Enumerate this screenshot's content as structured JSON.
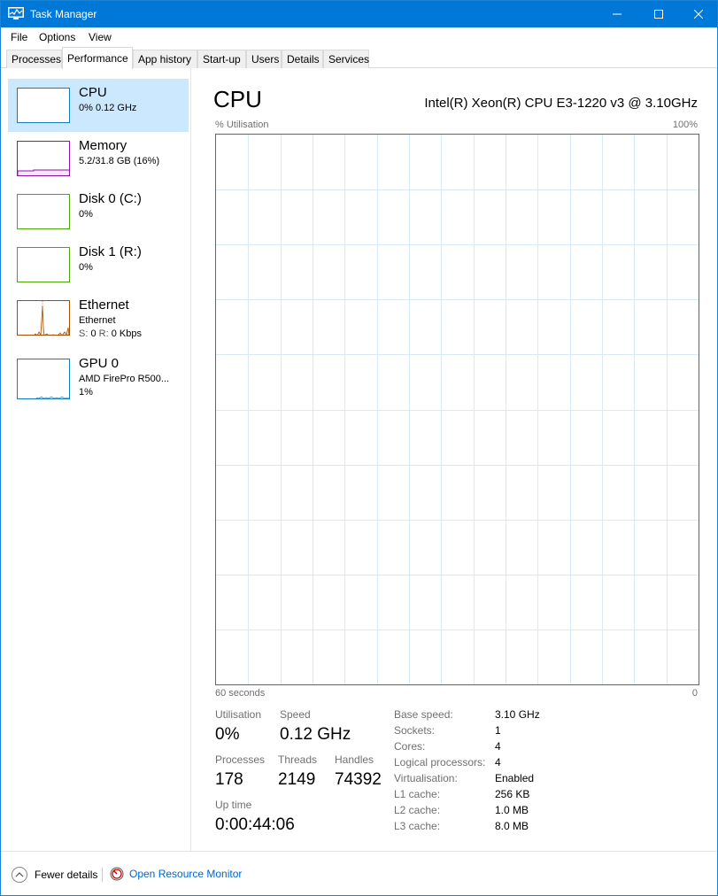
{
  "window": {
    "title": "Task Manager"
  },
  "menu": {
    "file": "File",
    "options": "Options",
    "view": "View"
  },
  "tabs": [
    {
      "label": "Processes"
    },
    {
      "label": "Performance"
    },
    {
      "label": "App history"
    },
    {
      "label": "Start-up"
    },
    {
      "label": "Users"
    },
    {
      "label": "Details"
    },
    {
      "label": "Services"
    }
  ],
  "sidebar": {
    "items": [
      {
        "name": "CPU",
        "sub": "0% 0.12 GHz",
        "color": "#117dbb"
      },
      {
        "name": "Memory",
        "sub": "5.2/31.8 GB (16%)",
        "color": "#8b12ae"
      },
      {
        "name": "Disk 0 (C:)",
        "sub": "0%",
        "color": "#4da60c"
      },
      {
        "name": "Disk 1 (R:)",
        "sub": "0%",
        "color": "#4da60c"
      },
      {
        "name": "Ethernet",
        "sub": "Ethernet",
        "sub2_send": "S:",
        "sub2_send_val": "0",
        "sub2_recv": "R:",
        "sub2_recv_val": "0 Kbps",
        "color": "#a74f01"
      },
      {
        "name": "GPU 0",
        "sub": "AMD FirePro R500...",
        "sub2": "1%",
        "color": "#117dbb"
      }
    ]
  },
  "main": {
    "title": "CPU",
    "model": "Intel(R) Xeon(R) CPU E3-1220 v3 @ 3.10GHz",
    "y_axis_label": "% Utilisation",
    "y_axis_max": "100%",
    "x_axis_left": "60 seconds",
    "x_axis_right": "0",
    "graph_color": "#117dbb",
    "grid_color": "#d9eaf4"
  },
  "stats": {
    "utilisation_label": "Utilisation",
    "utilisation_value": "0%",
    "speed_label": "Speed",
    "speed_value": "0.12 GHz",
    "processes_label": "Processes",
    "processes_value": "178",
    "threads_label": "Threads",
    "threads_value": "2149",
    "handles_label": "Handles",
    "handles_value": "74392",
    "uptime_label": "Up time",
    "uptime_value": "0:00:44:06"
  },
  "specs": [
    {
      "label": "Base speed:",
      "value": "3.10 GHz"
    },
    {
      "label": "Sockets:",
      "value": "1"
    },
    {
      "label": "Cores:",
      "value": "4"
    },
    {
      "label": "Logical processors:",
      "value": "4"
    },
    {
      "label": "Virtualisation:",
      "value": "Enabled"
    },
    {
      "label": "L1 cache:",
      "value": "256 KB"
    },
    {
      "label": "L2 cache:",
      "value": "1.0 MB"
    },
    {
      "label": "L3 cache:",
      "value": "8.0 MB"
    }
  ],
  "footer": {
    "fewer_details": "Fewer details",
    "open_resource_monitor": "Open Resource Monitor"
  }
}
